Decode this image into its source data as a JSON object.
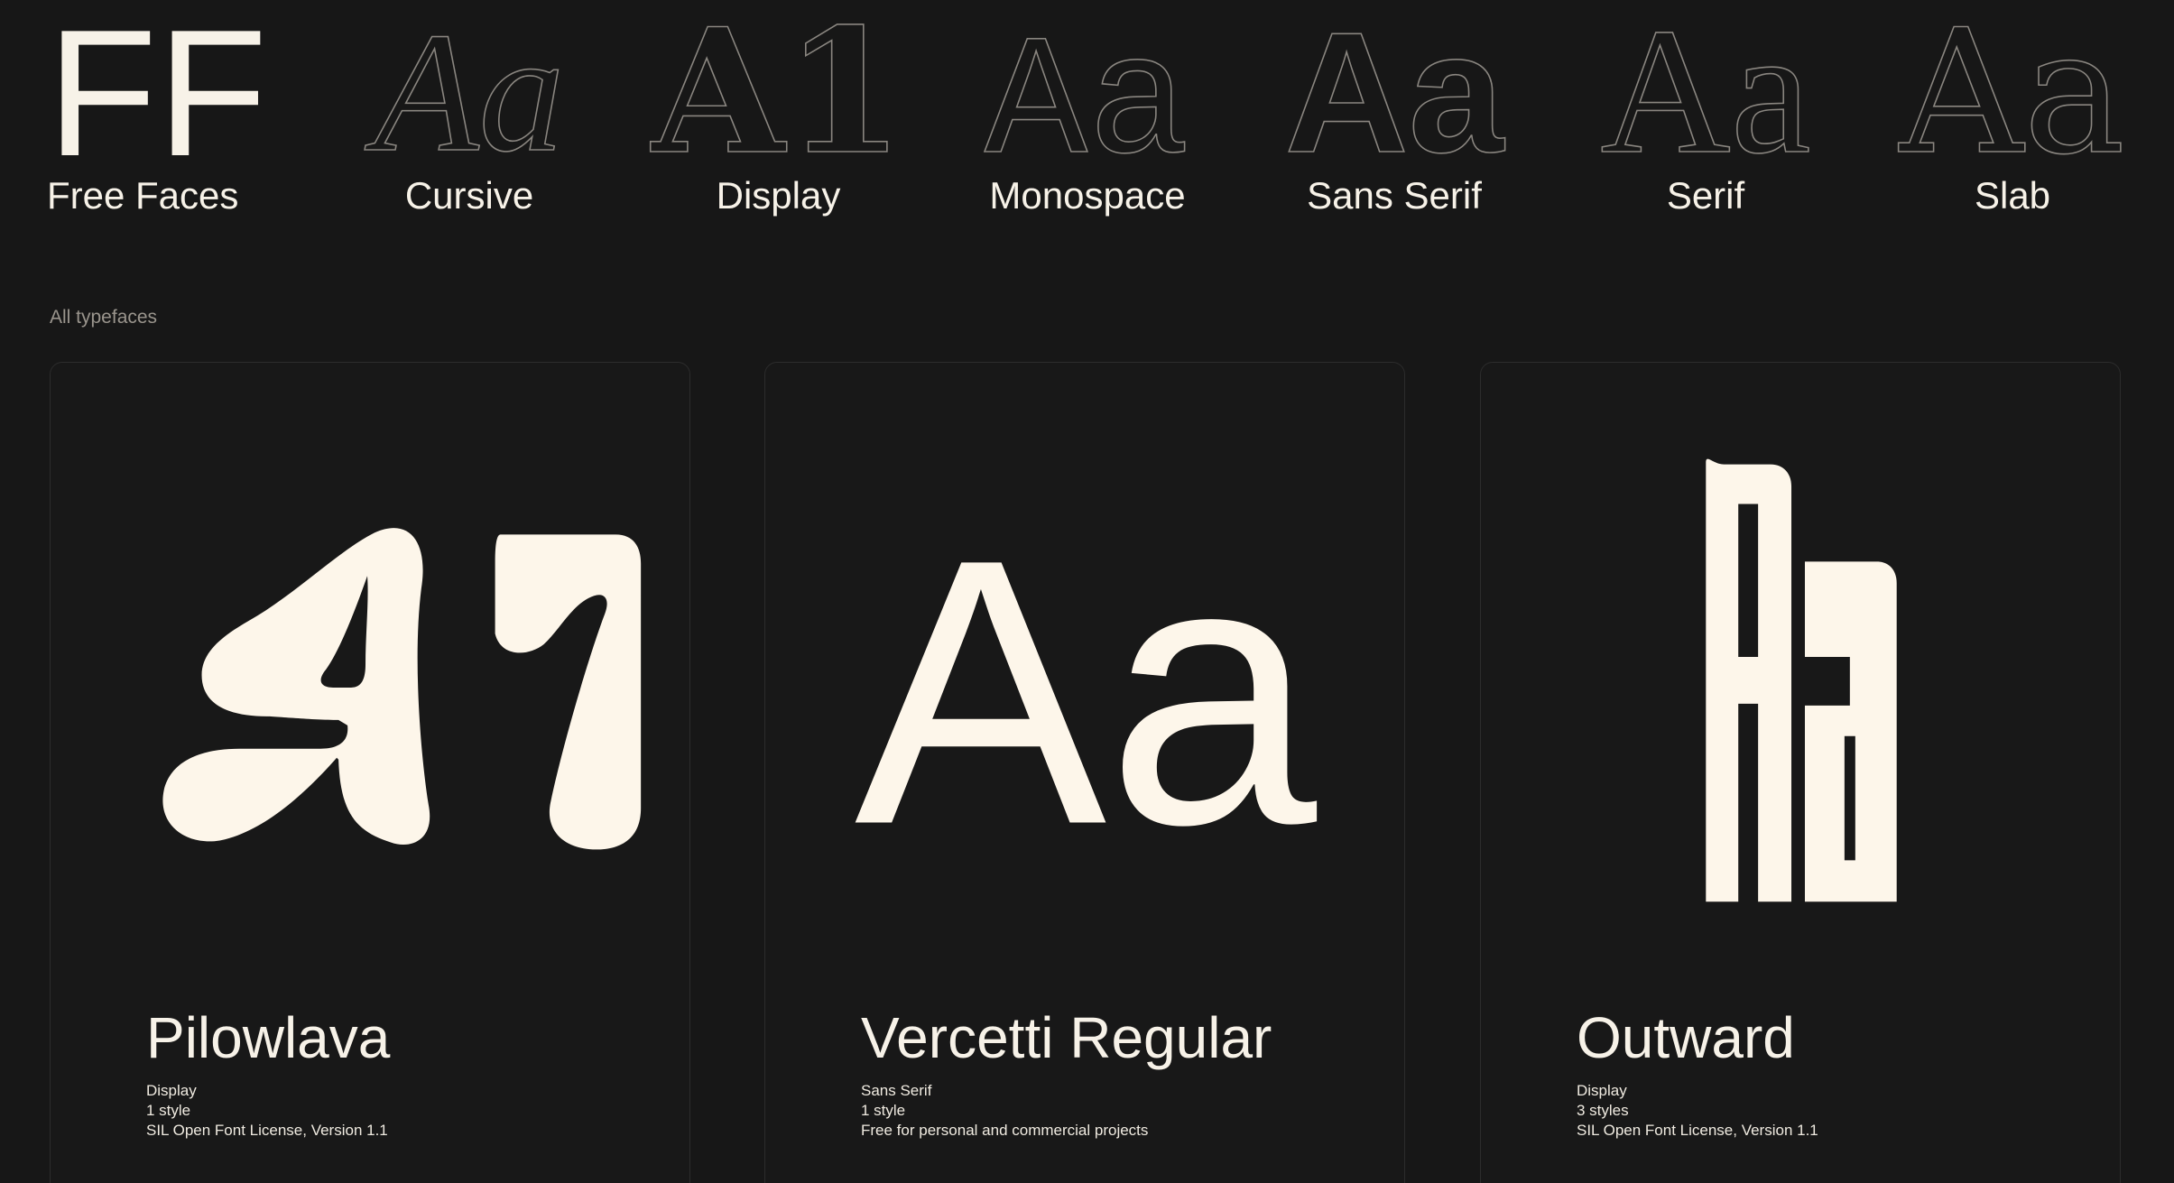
{
  "nav": {
    "brand": {
      "glyph": "FF",
      "label": "Free Faces"
    },
    "categories": [
      {
        "glyph": "Aa",
        "label": "Cursive"
      },
      {
        "glyph": "A1",
        "label": "Display"
      },
      {
        "glyph": "Aa",
        "label": "Monospace"
      },
      {
        "glyph": "Aa",
        "label": "Sans Serif"
      },
      {
        "glyph": "Aa",
        "label": "Serif"
      },
      {
        "glyph": "Aa",
        "label": "Slab"
      }
    ]
  },
  "section": {
    "label": "All typefaces"
  },
  "cards": [
    {
      "specimen": "A1",
      "name": "Pilowlava",
      "category": "Display",
      "styles": "1 style",
      "license": "SIL Open Font License, Version 1.1"
    },
    {
      "specimen": "Aa",
      "name": "Vercetti Regular",
      "category": "Sans Serif",
      "styles": "1 style",
      "license": "Free for personal and commercial projects"
    },
    {
      "specimen": "Aa",
      "name": "Outward",
      "category": "Display",
      "styles": "3 styles",
      "license": "SIL Open Font License, Version 1.1"
    }
  ],
  "colors": {
    "background": "#171717",
    "text": "#f7f2e8",
    "muted": "#9a958d",
    "card_border": "#2c2c2c"
  }
}
